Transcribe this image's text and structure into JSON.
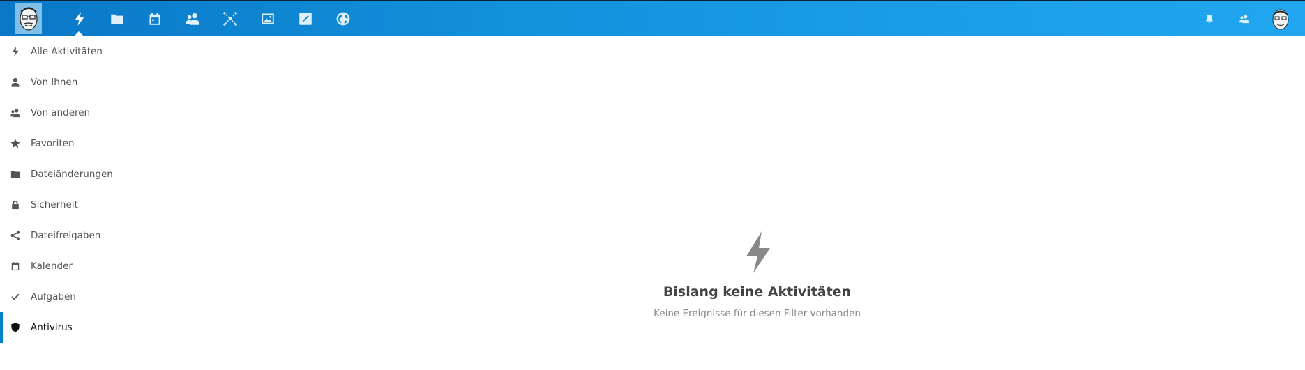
{
  "header": {
    "apps": [
      {
        "name": "activity",
        "icon": "lightning-icon",
        "active": true
      },
      {
        "name": "files",
        "icon": "folder-icon"
      },
      {
        "name": "calendar",
        "icon": "calendar-icon"
      },
      {
        "name": "contacts",
        "icon": "contacts-icon"
      },
      {
        "name": "circles",
        "icon": "network-icon"
      },
      {
        "name": "gallery",
        "icon": "image-icon"
      },
      {
        "name": "notes",
        "icon": "edit-icon"
      },
      {
        "name": "sites",
        "icon": "globe-icon"
      }
    ],
    "right": [
      "bell-icon",
      "contacts-menu-icon",
      "user-avatar"
    ]
  },
  "sidebar": {
    "items": [
      {
        "label": "Alle Aktivitäten",
        "icon": "lightning-icon"
      },
      {
        "label": "Von Ihnen",
        "icon": "person-icon"
      },
      {
        "label": "Von anderen",
        "icon": "people-icon"
      },
      {
        "label": "Favoriten",
        "icon": "star-icon"
      },
      {
        "label": "Dateiänderungen",
        "icon": "folder-icon"
      },
      {
        "label": "Sicherheit",
        "icon": "lock-icon"
      },
      {
        "label": "Dateifreigaben",
        "icon": "share-icon"
      },
      {
        "label": "Kalender",
        "icon": "calendar-icon"
      },
      {
        "label": "Aufgaben",
        "icon": "checkmark-icon"
      },
      {
        "label": "Antivirus",
        "icon": "shield-icon",
        "active": true
      }
    ]
  },
  "empty": {
    "title": "Bislang keine Aktivitäten",
    "subtitle": "Keine Ereignisse für diesen Filter vorhanden"
  },
  "colors": {
    "header_start": "#0a77c6",
    "header_end": "#22a6f0",
    "active_indicator": "#0082c9"
  }
}
